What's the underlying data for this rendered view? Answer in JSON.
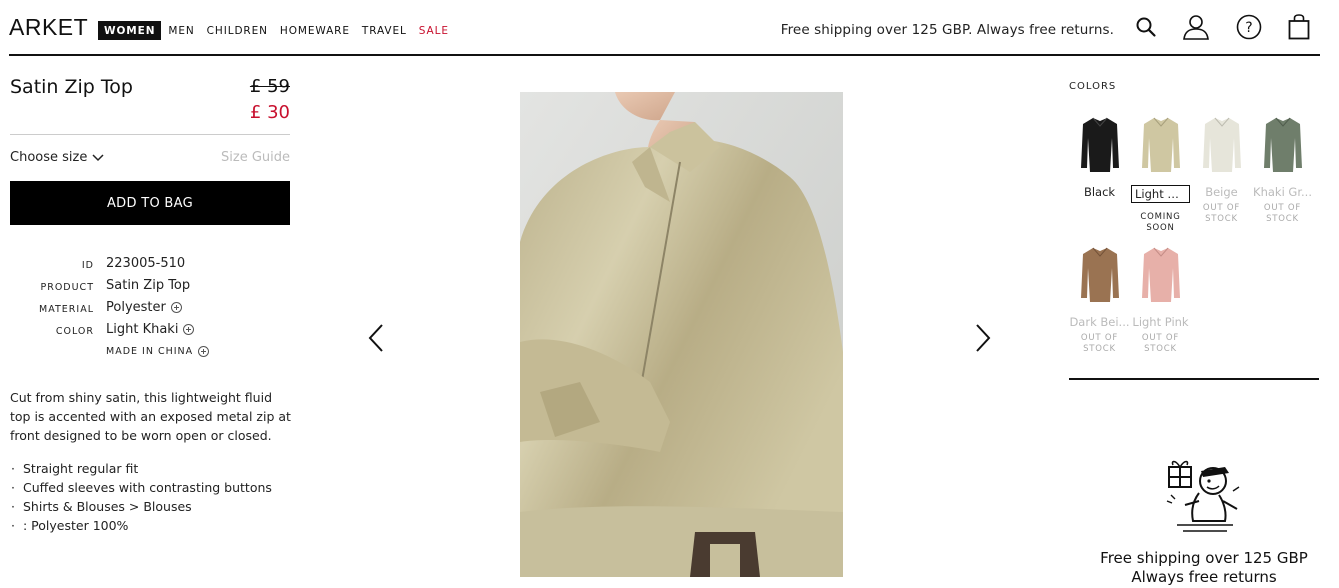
{
  "header": {
    "logo": "ARKET",
    "nav": [
      {
        "label": "WOMEN",
        "state": "active"
      },
      {
        "label": "MEN",
        "state": "normal"
      },
      {
        "label": "CHILDREN",
        "state": "normal"
      },
      {
        "label": "HOMEWARE",
        "state": "normal"
      },
      {
        "label": "TRAVEL",
        "state": "normal"
      },
      {
        "label": "SALE",
        "state": "sale"
      }
    ],
    "shipping_text": "Free shipping over 125 GBP. Always free returns.",
    "icons": [
      "search-icon",
      "account-icon",
      "help-icon",
      "bag-icon"
    ]
  },
  "product": {
    "title": "Satin Zip Top",
    "price_old": "£ 59",
    "price_new": "£ 30",
    "choose_size": "Choose size",
    "size_guide": "Size Guide",
    "add_to_bag": "ADD TO BAG",
    "specs": [
      {
        "label": "ID",
        "value": "223005-510",
        "expandable": false
      },
      {
        "label": "PRODUCT",
        "value": "Satin Zip Top",
        "expandable": false
      },
      {
        "label": "MATERIAL",
        "value": "Polyester",
        "expandable": true
      },
      {
        "label": "COLOR",
        "value": "Light Khaki",
        "expandable": true
      }
    ],
    "made_in": "MADE IN CHINA",
    "description": "Cut from shiny satin, this lightweight fluid top is accented with an exposed metal zip at front designed to be worn open or closed.",
    "bullets": [
      "Straight regular fit",
      "Cuffed sleeves with contrasting buttons",
      "Shirts & Blouses > Blouses",
      ": Polyester 100%"
    ]
  },
  "colors": {
    "title": "COLORS",
    "items": [
      {
        "name": "Black",
        "status": "",
        "selected": false,
        "available": true,
        "color": "#1a1a1a"
      },
      {
        "name": "Light Kh...",
        "status": "COMING SOON",
        "selected": true,
        "available": true,
        "color": "#cfc7a2"
      },
      {
        "name": "Beige",
        "status": "OUT OF STOCK",
        "selected": false,
        "available": false,
        "color": "#e6e5da"
      },
      {
        "name": "Khaki Gr...",
        "status": "OUT OF STOCK",
        "selected": false,
        "available": false,
        "color": "#6f7e6b"
      },
      {
        "name": "Dark Bei...",
        "status": "OUT OF STOCK",
        "selected": false,
        "available": false,
        "color": "#9a7352"
      },
      {
        "name": "Light Pink",
        "status": "OUT OF STOCK",
        "selected": false,
        "available": false,
        "color": "#e7b0a9"
      }
    ]
  },
  "promo": {
    "line1": "Free shipping over 125 GBP",
    "line2": "Always free returns"
  },
  "accent": {
    "sale": "#c8102e",
    "black": "#000000"
  }
}
